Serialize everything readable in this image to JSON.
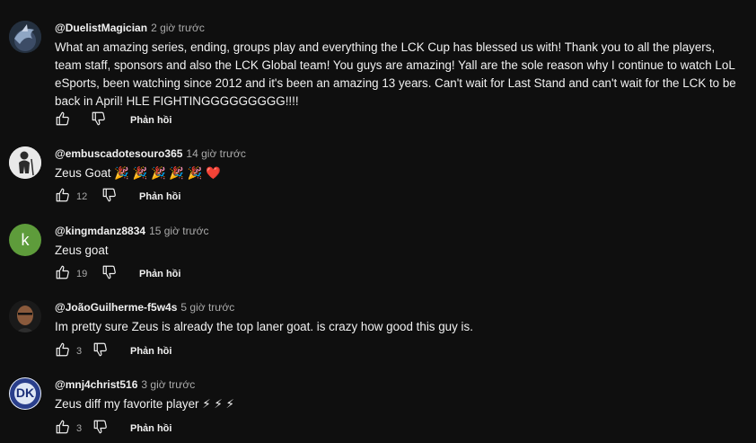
{
  "colors": {
    "background": "#0f0f0f",
    "text": "#f1f1f1",
    "muted": "#aaaaaa",
    "avatar_k": "#5e9c3b",
    "heart": "#e0245e",
    "lightning": "#f5c542"
  },
  "reply_label": "Phản hồi",
  "comments": [
    {
      "handle": "@DuelistMagician",
      "time": "2 giờ trước",
      "text": "What an amazing series, ending, groups play and everything the LCK Cup has blessed us with! Thank you to all the players, team staff, sponsors and also the LCK Global team! You guys are amazing! Yall are the sole reason why I continue to watch LoL eSports, been watching since 2012 and it's been an amazing 13 years. Can't wait for Last Stand and can't wait for the LCK to be back in April! HLE FIGHTINGGGGGGGGG!!!!",
      "likes": "",
      "avatar_icon": "dragon-avatar-icon"
    },
    {
      "handle": "@embuscadotesouro365",
      "time": "14 giờ trước",
      "text": "Zeus Goat 🎉 🎉 🎉 🎉 🎉 ❤️",
      "likes": "12",
      "avatar_icon": "person-avatar-icon"
    },
    {
      "handle": "@kingmdanz8834",
      "time": "15 giờ trước",
      "text": "Zeus goat",
      "likes": "19",
      "avatar_letter": "k"
    },
    {
      "handle": "@JoãoGuilherme-f5w4s",
      "time": "5 giờ trước",
      "text": "Im pretty sure Zeus is already the top laner goat. is crazy how good this guy is.",
      "likes": "3",
      "avatar_icon": "face-avatar-icon"
    },
    {
      "handle": "@mnj4christ516",
      "time": "3 giờ trước",
      "text": "Zeus diff my favorite player ⚡ ⚡ ⚡",
      "likes": "3",
      "avatar_letter": "DK"
    }
  ]
}
